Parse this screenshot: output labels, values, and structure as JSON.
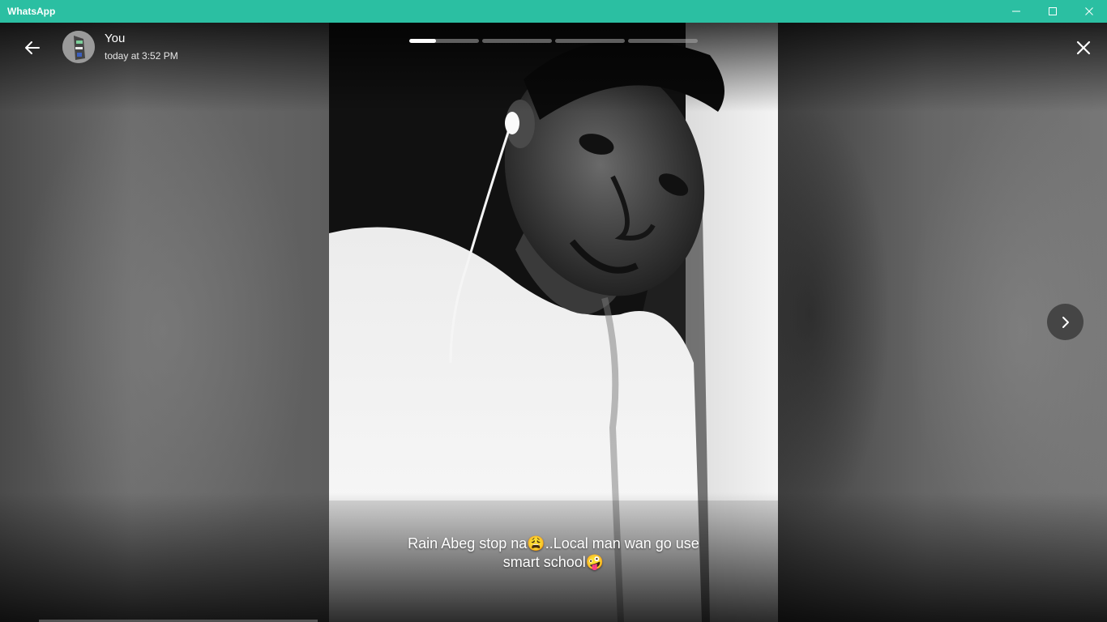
{
  "window": {
    "title": "WhatsApp",
    "controls": [
      "minimize-icon",
      "maximize-icon",
      "close-icon"
    ],
    "accent": "#2bbfa2"
  },
  "status": {
    "user_name": "You",
    "timestamp": "today at 3:52 PM",
    "progress": [
      0.38,
      0,
      0,
      0
    ],
    "caption": "Rain Abeg stop na😩..Local man wan go use smart school🤪"
  },
  "icons": {
    "back": "arrow-left-icon",
    "close": "close-icon",
    "next": "chevron-right-icon"
  }
}
